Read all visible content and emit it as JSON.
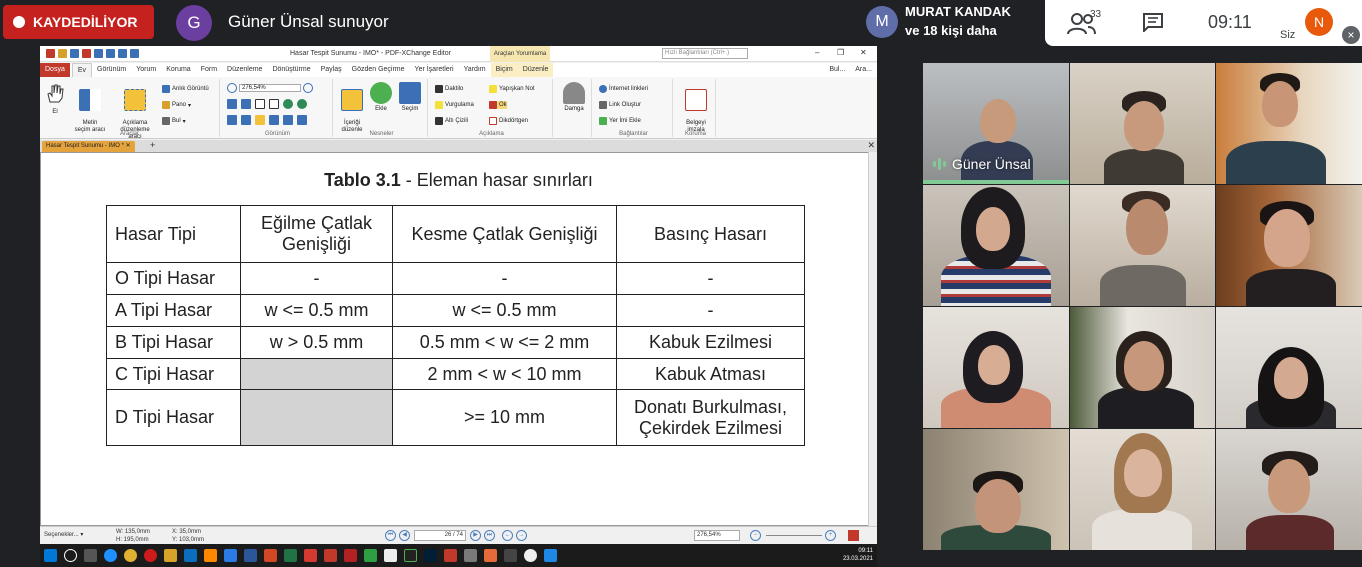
{
  "meet": {
    "recording_label": "KAYDEDİLİYOR",
    "presenter_initial": "G",
    "presenter_text": "Güner Ünsal sunuyor",
    "message": {
      "initial": "M",
      "name": "MURAT KANDAK",
      "sub": "ve 18 kişi daha"
    },
    "people_count": "33",
    "time": "09:11",
    "self_initial": "N",
    "self_label": "Siz",
    "close_glyph": "×"
  },
  "editor": {
    "window_title": "Hasar Tespit Sunumu - IMO* - PDF-XChange Editor",
    "context_label": "Araçları Yorumlama",
    "search_placeholder": "Hızlı Bağlantıları (Ctrl+.)",
    "menu": [
      "Dosya",
      "Ev",
      "Görünüm",
      "Yorum",
      "Koruma",
      "Form",
      "Düzenleme",
      "Dönüştürme",
      "Paylaş",
      "Gözden Geçirme",
      "Yer İşaretleri",
      "Yardım",
      "Biçim",
      "Düzenle"
    ],
    "menu_right": [
      "Bul...",
      "Ara..."
    ],
    "ribbon": {
      "el": "El",
      "metin": "Metin\nseçim aracı",
      "aciklama": "Açıklama\ndüzenleme aracı",
      "araclar": "Araçlar",
      "anlik": "Anlık Görüntü",
      "pano": "Pano",
      "bul": "Bul",
      "zoom": "276,54%",
      "gorunum": "Görünüm",
      "icerigi": "İçeriği\ndüzenle",
      "ekle": "Ekle",
      "secim": "Seçim",
      "nesneler": "Nesneler",
      "daktilo": "Daktilo",
      "vurgulama": "Vurgulama",
      "alti_cizili": "Altı Çizili",
      "yapiskan": "Yapışkan Not",
      "ok": "Ok",
      "dikdortgen": "Dikdörtgen",
      "aciklama_grp": "Açıklama",
      "damga": "Damga",
      "internet": "İnternet linkleri",
      "link": "Link Oluştur",
      "yer_imi": "Yer İmi Ekle",
      "baglantilar": "Bağlantılar",
      "belgeyi": "Belgeyi\nimzala",
      "koruma": "Koruma"
    },
    "doc_tab": "Hasar Tespit Sunumu - IMO *",
    "table_title_bold": "Tablo 3.1",
    "table_title_rest": " - Eleman hasar sınırları",
    "table": {
      "headers": [
        "Hasar Tipi",
        "Eğilme Çatlak\nGenişliği",
        "Kesme Çatlak Genişliği",
        "Basınç Hasarı"
      ],
      "rows": [
        [
          "O Tipi Hasar",
          "-",
          "-",
          "-"
        ],
        [
          "A Tipi Hasar",
          "w <= 0.5 mm",
          "w <= 0.5 mm",
          "-"
        ],
        [
          "B Tipi Hasar",
          "w > 0.5 mm",
          "0.5 mm < w <= 2 mm",
          "Kabuk Ezilmesi"
        ],
        [
          "C Tipi Hasar",
          "",
          "2 mm < w < 10 mm",
          "Kabuk Atması"
        ],
        [
          "D Tipi Hasar",
          "",
          ">= 10 mm",
          "Donatı Burkulması,\nÇekirdek Ezilmesi"
        ]
      ]
    },
    "status": {
      "secenekler": "Seçenekler...",
      "w": "W: 135,0mm",
      "h": "H: 195,0mm",
      "x": "X: 35,0mm",
      "y": "Y: 103,0mm",
      "page": "26 / 74",
      "zoom": "276,54%"
    },
    "clock": {
      "time": "09:11",
      "date": "23.03.2021"
    }
  },
  "participants": {
    "speaker_name": "Güner Ünsal"
  },
  "colors": {
    "recording": "#c5221f",
    "speaking": "#81c995",
    "presenter_avatar": "#6b3fa0",
    "self_avatar": "#e8590c"
  }
}
